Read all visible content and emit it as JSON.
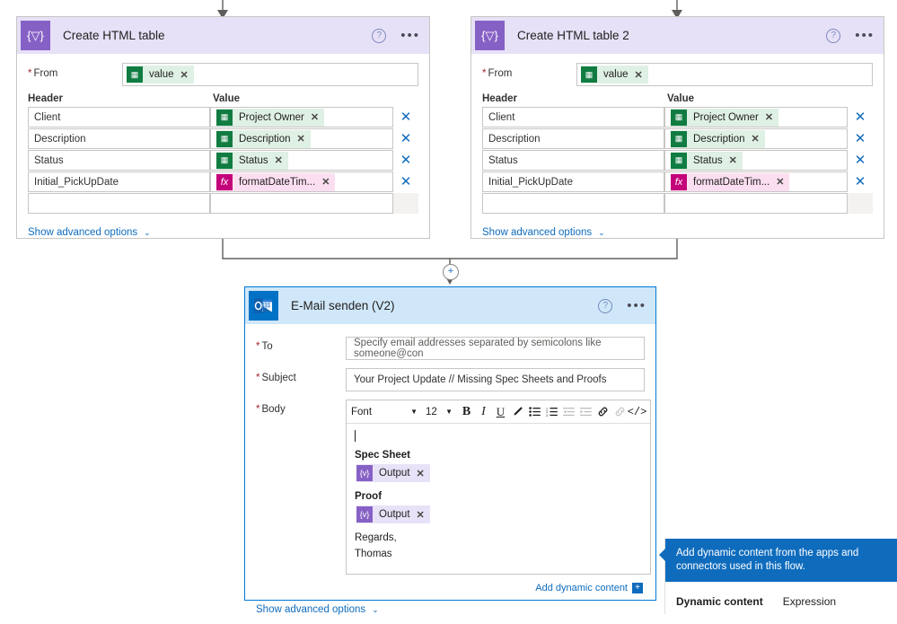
{
  "cards": [
    {
      "id": "create-html-table",
      "title": "Create HTML table",
      "icon": "data-operations-icon",
      "icon_glyph": "{▽}",
      "help_icon": "help-icon",
      "more_icon": "more-options-icon",
      "from": {
        "label": "From",
        "required": "*",
        "token": {
          "text": "value",
          "kind": "excel",
          "icon": "excel-icon",
          "remove": "✕"
        }
      },
      "columns": {
        "header": "Header",
        "value": "Value"
      },
      "rows": [
        {
          "header": "Client",
          "token": {
            "text": "Project Owner",
            "kind": "excel",
            "icon": "excel-icon",
            "remove": "✕"
          },
          "delete": "✕"
        },
        {
          "header": "Description",
          "token": {
            "text": "Description",
            "kind": "excel",
            "icon": "excel-icon",
            "remove": "✕"
          },
          "delete": "✕"
        },
        {
          "header": "Status",
          "token": {
            "text": "Status",
            "kind": "excel",
            "icon": "excel-icon",
            "remove": "✕"
          },
          "delete": "✕"
        },
        {
          "header": "Initial_PickUpDate",
          "token": {
            "text": "formatDateTim...",
            "kind": "expr",
            "icon": "function-icon",
            "remove": "✕"
          },
          "delete": "✕"
        },
        {
          "header": "",
          "token": null,
          "delete": ""
        }
      ],
      "advanced_link": "Show advanced options",
      "advanced_chevron": "⌄"
    },
    {
      "id": "create-html-table-2",
      "title": "Create HTML table 2",
      "icon": "data-operations-icon",
      "icon_glyph": "{▽}",
      "help_icon": "help-icon",
      "more_icon": "more-options-icon",
      "from": {
        "label": "From",
        "required": "*",
        "token": {
          "text": "value",
          "kind": "excel",
          "icon": "excel-icon",
          "remove": "✕"
        }
      },
      "columns": {
        "header": "Header",
        "value": "Value"
      },
      "rows": [
        {
          "header": "Client",
          "token": {
            "text": "Project Owner",
            "kind": "excel",
            "icon": "excel-icon",
            "remove": "✕"
          },
          "delete": "✕"
        },
        {
          "header": "Description",
          "token": {
            "text": "Description",
            "kind": "excel",
            "icon": "excel-icon",
            "remove": "✕"
          },
          "delete": "✕"
        },
        {
          "header": "Status",
          "token": {
            "text": "Status",
            "kind": "excel",
            "icon": "excel-icon",
            "remove": "✕"
          },
          "delete": "✕"
        },
        {
          "header": "Initial_PickUpDate",
          "token": {
            "text": "formatDateTim...",
            "kind": "expr",
            "icon": "function-icon",
            "remove": "✕"
          },
          "delete": "✕"
        },
        {
          "header": "",
          "token": null,
          "delete": ""
        }
      ],
      "advanced_link": "Show advanced options",
      "advanced_chevron": "⌄"
    }
  ],
  "email_card": {
    "title": "E-Mail senden (V2)",
    "icon": "outlook-icon",
    "help_icon": "help-icon",
    "more_icon": "more-options-icon",
    "to": {
      "label": "To",
      "required": "*",
      "placeholder": "Specify email addresses separated by semicolons like someone@con",
      "value": ""
    },
    "subject": {
      "label": "Subject",
      "required": "*",
      "value": "Your Project Update // Missing Spec Sheets and Proofs"
    },
    "body": {
      "label": "Body",
      "required": "*",
      "toolbar": {
        "font_label": "Font",
        "font_caret": "▼",
        "size_label": "12",
        "size_caret": "▼",
        "bold": "B",
        "italic": "I",
        "underline": "U",
        "text_color": "pen-icon",
        "bulleted_list": "bulleted-list-icon",
        "numbered_list": "numbered-list-icon",
        "outdent": "outdent-icon",
        "indent": "indent-icon",
        "link": "link-icon",
        "unlink": "unlink-icon",
        "code_view": "</>"
      },
      "content": [
        {
          "type": "caret",
          "text": ""
        },
        {
          "type": "bold",
          "text": "Spec Sheet"
        },
        {
          "type": "token",
          "token": {
            "text": "Output",
            "kind": "dataop",
            "icon": "data-operations-icon",
            "icon_glyph": "{v}",
            "remove": "✕"
          }
        },
        {
          "type": "bold",
          "text": "Proof"
        },
        {
          "type": "token",
          "token": {
            "text": "Output",
            "kind": "dataop",
            "icon": "data-operations-icon",
            "icon_glyph": "{v}",
            "remove": "✕"
          }
        },
        {
          "type": "text",
          "text": "Regards,"
        },
        {
          "type": "text",
          "text": "Thomas"
        }
      ],
      "add_dynamic_content": "Add dynamic content",
      "add_dynamic_plus": "+"
    },
    "advanced_link": "Show advanced options",
    "advanced_chevron": "⌄"
  },
  "dynamic_panel": {
    "tooltip": "Add dynamic content from the apps and connectors used in this flow.",
    "tabs": [
      {
        "label": "Dynamic content",
        "active": true
      },
      {
        "label": "Expression",
        "active": false
      }
    ]
  },
  "connectors": {
    "insert_button": "+",
    "insert_icon": "add-step-icon"
  },
  "colors": {
    "dataops_purple": "#8661c5",
    "dataops_header": "#e6e1f7",
    "outlook_blue": "#0072c6",
    "outlook_header": "#cfe7f9",
    "excel_green": "#107c41",
    "expression_magenta": "#c4007a",
    "link_blue": "#0f6cbd",
    "selected_border": "#0078d4",
    "required_red": "#a4262c"
  }
}
